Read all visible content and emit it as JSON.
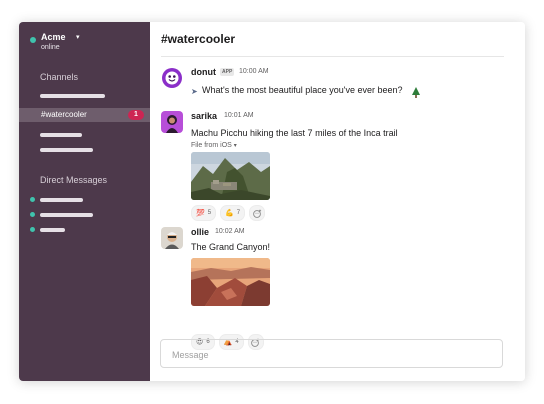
{
  "workspace": {
    "name": "Acme",
    "status": "online"
  },
  "sidebar": {
    "channels_heading": "Channels",
    "active_channel": {
      "name": "#watercooler",
      "unread": "1"
    },
    "dms_heading": "Direct Messages"
  },
  "channel": {
    "title": "#watercooler"
  },
  "messages": [
    {
      "author": "donut",
      "app_badge": "APP",
      "time": "10:00 AM",
      "text": "What's the most beautiful place you've ever been?"
    },
    {
      "author": "sarika",
      "time": "10:01 AM",
      "text": "Machu Picchu hiking the last 7 miles of the Inca trail",
      "file_label": "File from iOS",
      "reactions": [
        {
          "emoji": "💯",
          "count": "5"
        },
        {
          "emoji": "💪",
          "count": "7"
        }
      ]
    },
    {
      "author": "ollie",
      "time": "10:02 AM",
      "text": "The Grand Canyon!",
      "reactions": [
        {
          "emoji": "😍",
          "count": "6"
        },
        {
          "emoji": "⛺",
          "count": "4"
        }
      ]
    }
  ],
  "composer": {
    "placeholder": "Message"
  },
  "colors": {
    "sidebar_bg": "#4d394b",
    "sidebar_active": "#6e5d6c",
    "presence": "#3fc3ad",
    "unread_badge": "#cd2553",
    "donut_avatar": "#8b2fc9",
    "sarika_avatar": "#b74ed8"
  },
  "icons": {
    "workspace_menu": "chevron-down-icon",
    "file_menu": "chevron-down-icon",
    "add_reaction": "add-reaction-icon"
  }
}
